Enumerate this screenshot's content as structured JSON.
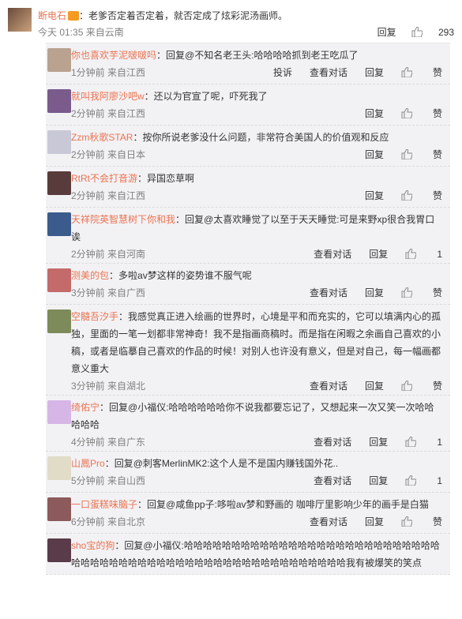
{
  "comment": {
    "user": "断电石",
    "text": "：老爹否定着否定着，就否定成了炫彩泥汤画师。",
    "time": "今天 01:35",
    "source": "来自云南",
    "reply_label": "回复",
    "likes": "293"
  },
  "labels": {
    "reply": "回复",
    "like": "赞",
    "report": "投诉",
    "dialog": "查看对话"
  },
  "replies": [
    {
      "user": "你也喜欢芋泥啵啵吗",
      "text": "：回复@不知名老王头:哈哈哈哈抓到老王吃瓜了",
      "time": "1分钟前",
      "source": "来自江西",
      "likes": "赞"
    },
    {
      "user": "就叫我阿廖沙吧w",
      "text": "：还以为官宣了呢，吓死我了",
      "time": "2分钟前",
      "source": "来自江西",
      "likes": "赞"
    },
    {
      "user": "Zzm秋歌STAR",
      "text": "：按你所说老爹没什么问题，非常符合美国人的价值观和反应",
      "time": "2分钟前",
      "source": "来自日本",
      "likes": "赞"
    },
    {
      "user": "RtRt不会打音游",
      "text": "：异国恋草啊",
      "time": "2分钟前",
      "source": "来自江西",
      "likes": "赞"
    },
    {
      "user": "天祥院英智慧树下你和我",
      "text": "：回复@太喜欢睡觉了以至于天天睡觉:可是来野xp很合我胃口诶",
      "time": "2分钟前",
      "source": "来自河南",
      "likes": "1"
    },
    {
      "user": "测美的包",
      "text": "：多啦av梦这样的姿势谁不服气呢",
      "time": "3分钟前",
      "source": "来自广西",
      "likes": "赞"
    },
    {
      "user": "空髓吾汐手",
      "text": "：我感觉真正进入绘画的世界时，心境是平和而充实的，它可以填满内心的孤独，里面的一笔一划都非常神奇！我不是指画商稿时。而是指在闲暇之余画自己喜欢的小稿，或者是临摹自己喜欢的作品的时候！对别人也许没有意义，但是对自己，每一幅画都意义重大",
      "time": "3分钟前",
      "source": "来自湖北",
      "likes": "赞"
    },
    {
      "user": "绮佑宁",
      "text": "：回复@小福仪:哈哈哈哈哈哈你不说我都要忘记了，又想起来一次又笑一次哈哈哈哈哈",
      "time": "4分钟前",
      "source": "来自广东",
      "likes": "1"
    },
    {
      "user": "山鳳Pro",
      "text": "：回复@刺客MerlinMK2:这个人是不是国内赚钱国外花..",
      "time": "5分钟前",
      "source": "来自山西",
      "likes": "1"
    },
    {
      "user": "一口蛋糕味脑子",
      "text": "：回复@咸鱼pp子:哆啦av梦和野画的 咖啡厅里影响少年的画手是白猫",
      "time": "6分钟前",
      "source": "来自北京",
      "likes": "赞"
    },
    {
      "user": "sho宝的狗",
      "text": "：回复@小福仪:哈哈哈哈哈哈哈哈哈哈哈哈哈哈哈哈哈哈哈哈哈哈哈哈哈哈哈哈哈哈哈哈哈哈哈哈哈哈哈哈哈哈哈哈哈哈哈哈哈哈哈哈哈哈哈哈我有被爆笑的笑点",
      "time": "",
      "source": "",
      "likes": ""
    }
  ]
}
